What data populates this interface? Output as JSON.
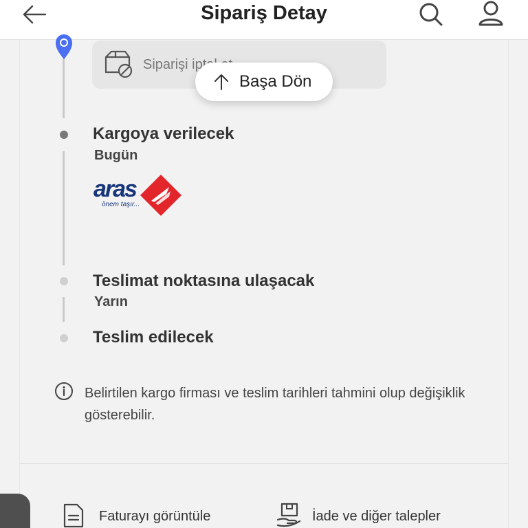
{
  "header": {
    "title": "Sipariş Detay",
    "icons": [
      "back-arrow-icon",
      "search-icon",
      "user-icon"
    ]
  },
  "cancel_card": {
    "text": "Siparişi iptal et",
    "icon": "package-cancel-icon"
  },
  "scroll_top": {
    "label": "Başa Dön",
    "icon": "arrow-up-icon"
  },
  "timeline": {
    "steps": [
      {
        "title": "Kargoya verilecek",
        "subtitle": "Bugün"
      },
      {
        "title": "Teslimat noktasına ulaşacak",
        "subtitle": "Yarın"
      },
      {
        "title": "Teslim edilecek",
        "subtitle": ""
      }
    ]
  },
  "carrier": {
    "name": "aras",
    "tagline": "önem taşır..."
  },
  "info_note": {
    "text": "Belirtilen kargo firması ve teslim tarihleri tahmini olup değişiklik gösterebilir."
  },
  "footer": {
    "invoice_label": "Faturayı görüntüle",
    "return_label": "İade ve diğer talepler"
  },
  "colors": {
    "accent_blue": "#4a6ff0",
    "aras_blue": "#16357a",
    "aras_red": "#e2262b"
  }
}
